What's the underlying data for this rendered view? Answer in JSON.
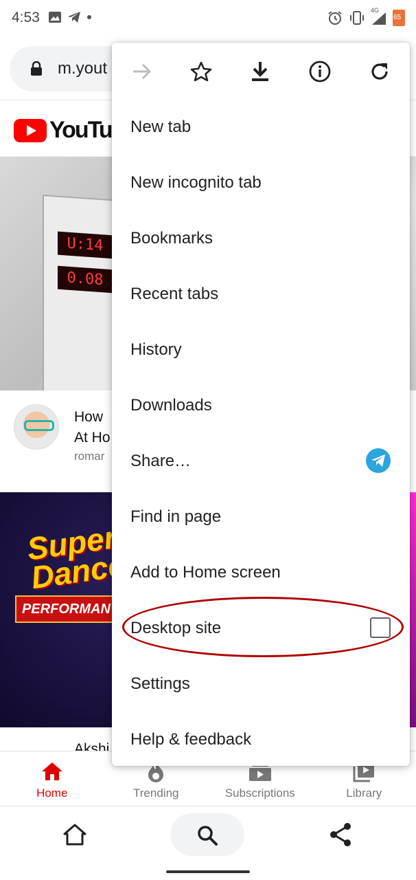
{
  "status_bar": {
    "time": "4:53",
    "network": "4G",
    "battery": "65"
  },
  "url_bar": {
    "url_text": "m.yout"
  },
  "youtube": {
    "logo_text": "YouTube",
    "video1": {
      "title_line1": "How",
      "title_line2": "At Ho",
      "channel": "romar",
      "display_top": "U:14",
      "display_bottom": "0.08"
    },
    "video2": {
      "title_partial": "Akshi",
      "thumb_title_line1": "Super",
      "thumb_title_line2": "Dance",
      "thumb_band": "PERFORMAN"
    }
  },
  "yt_nav": [
    {
      "label": "Home",
      "icon": "home-icon",
      "active": true
    },
    {
      "label": "Trending",
      "icon": "trending-icon",
      "active": false
    },
    {
      "label": "Subscriptions",
      "icon": "subscriptions-icon",
      "active": false
    },
    {
      "label": "Library",
      "icon": "library-icon",
      "active": false
    }
  ],
  "menu": {
    "icon_row": [
      "forward-icon",
      "bookmark-star-icon",
      "download-icon",
      "info-icon",
      "reload-icon"
    ],
    "items": [
      {
        "label": "New tab"
      },
      {
        "label": "New incognito tab"
      },
      {
        "label": "Bookmarks"
      },
      {
        "label": "Recent tabs"
      },
      {
        "label": "History"
      },
      {
        "label": "Downloads"
      },
      {
        "label": "Share…",
        "trailing": "telegram-icon"
      },
      {
        "label": "Find in page"
      },
      {
        "label": "Add to Home screen"
      },
      {
        "label": "Desktop site",
        "trailing": "checkbox",
        "checked": false
      },
      {
        "label": "Settings"
      },
      {
        "label": "Help & feedback"
      }
    ]
  },
  "colors": {
    "youtube_red": "#ff0000",
    "active_tab": "#e00000",
    "highlight": "#b00000",
    "telegram": "#2aa5e0"
  }
}
